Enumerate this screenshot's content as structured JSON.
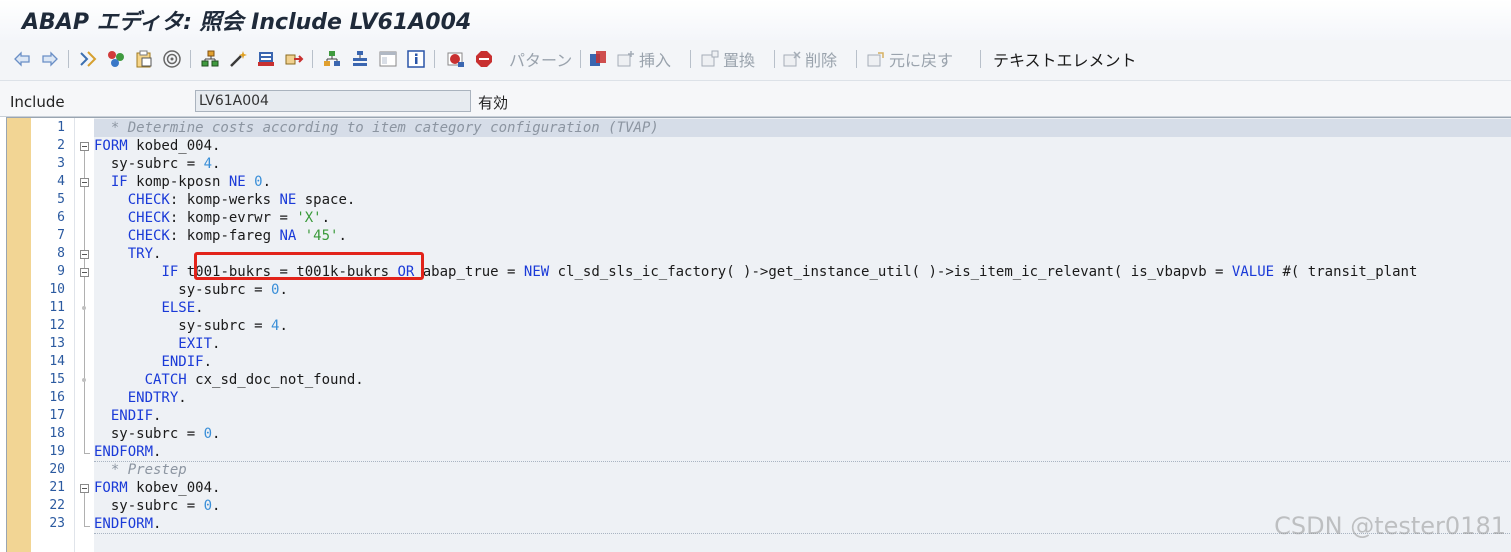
{
  "window": {
    "title": "ABAP エディタ: 照会 Include LV61A004"
  },
  "toolbar": {
    "pattern_label": "パターン",
    "insert_label": "挿入",
    "replace_label": "置換",
    "delete_label": "削除",
    "undo_label": "元に戻す",
    "text_elements_label": "テキストエレメント"
  },
  "include_bar": {
    "label": "Include",
    "value": "LV61A004",
    "status": "有効"
  },
  "editor": {
    "lines": [
      {
        "n": "1",
        "code": "  * Determine costs according to item category configuration (TVAP)"
      },
      {
        "n": "2",
        "code": "FORM kobed_004."
      },
      {
        "n": "3",
        "code": "  sy-subrc = 4."
      },
      {
        "n": "4",
        "code": "  IF komp-kposn NE 0."
      },
      {
        "n": "5",
        "code": "    CHECK: komp-werks NE space."
      },
      {
        "n": "6",
        "code": "    CHECK: komp-evrwr = 'X'."
      },
      {
        "n": "7",
        "code": "    CHECK: komp-fareg NA '45'."
      },
      {
        "n": "8",
        "code": "    TRY."
      },
      {
        "n": "9",
        "code": "        IF t001-bukrs = t001k-bukrs OR abap_true = NEW cl_sd_sls_ic_factory( )->get_instance_util( )->is_item_ic_relevant( is_vbapvb = VALUE #( transit_plant"
      },
      {
        "n": "10",
        "code": "          sy-subrc = 0."
      },
      {
        "n": "11",
        "code": "        ELSE."
      },
      {
        "n": "12",
        "code": "          sy-subrc = 4."
      },
      {
        "n": "13",
        "code": "          EXIT."
      },
      {
        "n": "14",
        "code": "        ENDIF."
      },
      {
        "n": "15",
        "code": "      CATCH cx_sd_doc_not_found."
      },
      {
        "n": "16",
        "code": "    ENDTRY."
      },
      {
        "n": "17",
        "code": "  ENDIF."
      },
      {
        "n": "18",
        "code": "  sy-subrc = 0."
      },
      {
        "n": "19",
        "code": "ENDFORM."
      },
      {
        "n": "20",
        "code": "  * Prestep"
      },
      {
        "n": "21",
        "code": "FORM kobev_004."
      },
      {
        "n": "22",
        "code": "  sy-subrc = 0."
      },
      {
        "n": "23",
        "code": "ENDFORM."
      }
    ]
  },
  "watermark": "CSDN @tester0181",
  "colors": {
    "keyword": "#1a3ad8",
    "comment": "#8c95a1",
    "string": "#3a9a3a",
    "number": "#3a8fd8",
    "highlight_box": "#e2231a",
    "left_edge": "#f2d594"
  }
}
